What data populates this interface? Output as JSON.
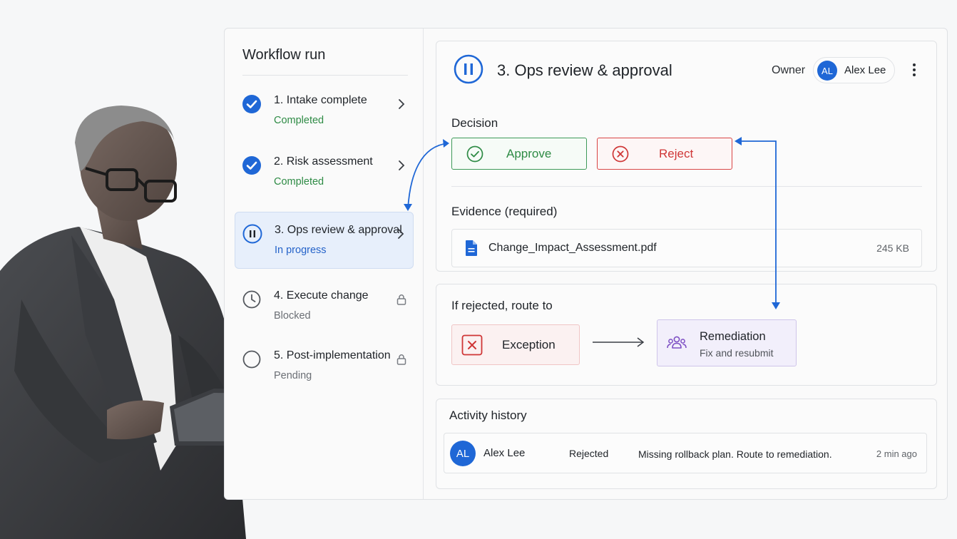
{
  "sidebar": {
    "title": "Workflow run",
    "steps": [
      {
        "label": "1. Intake complete",
        "status": "Completed",
        "state": "completed"
      },
      {
        "label": "2. Risk assessment",
        "status": "Completed",
        "state": "completed"
      },
      {
        "label": "3. Ops review & approval",
        "status": "In progress",
        "state": "in-progress"
      },
      {
        "label": "4. Execute change",
        "status": "Blocked",
        "state": "blocked"
      },
      {
        "label": "5. Post-implementation",
        "status": "Pending",
        "state": "pending"
      }
    ]
  },
  "detail": {
    "title": "3. Ops review & approval",
    "owner_label": "Owner",
    "owner_initials": "AL",
    "owner_name": "Alex Lee",
    "decision_label": "Decision",
    "approve_label": "Approve",
    "reject_label": "Reject",
    "evidence_label": "Evidence (required)",
    "file_name": "Change_Impact_Assessment.pdf",
    "file_size": "245 KB"
  },
  "routing": {
    "label": "If rejected, route to",
    "exception_label": "Exception",
    "target_title": "Remediation",
    "target_subtitle": "Fix and resubmit"
  },
  "history": {
    "title": "Activity history",
    "entries": [
      {
        "initials": "AL",
        "name": "Alex Lee",
        "action": "Rejected",
        "message": "Missing rollback plan. Route to remediation.",
        "time": "2 min ago"
      }
    ]
  },
  "colors": {
    "accent": "#1f67d6",
    "success": "#2e8b45",
    "danger": "#cf3636",
    "remediation": "#7d4fc4"
  }
}
